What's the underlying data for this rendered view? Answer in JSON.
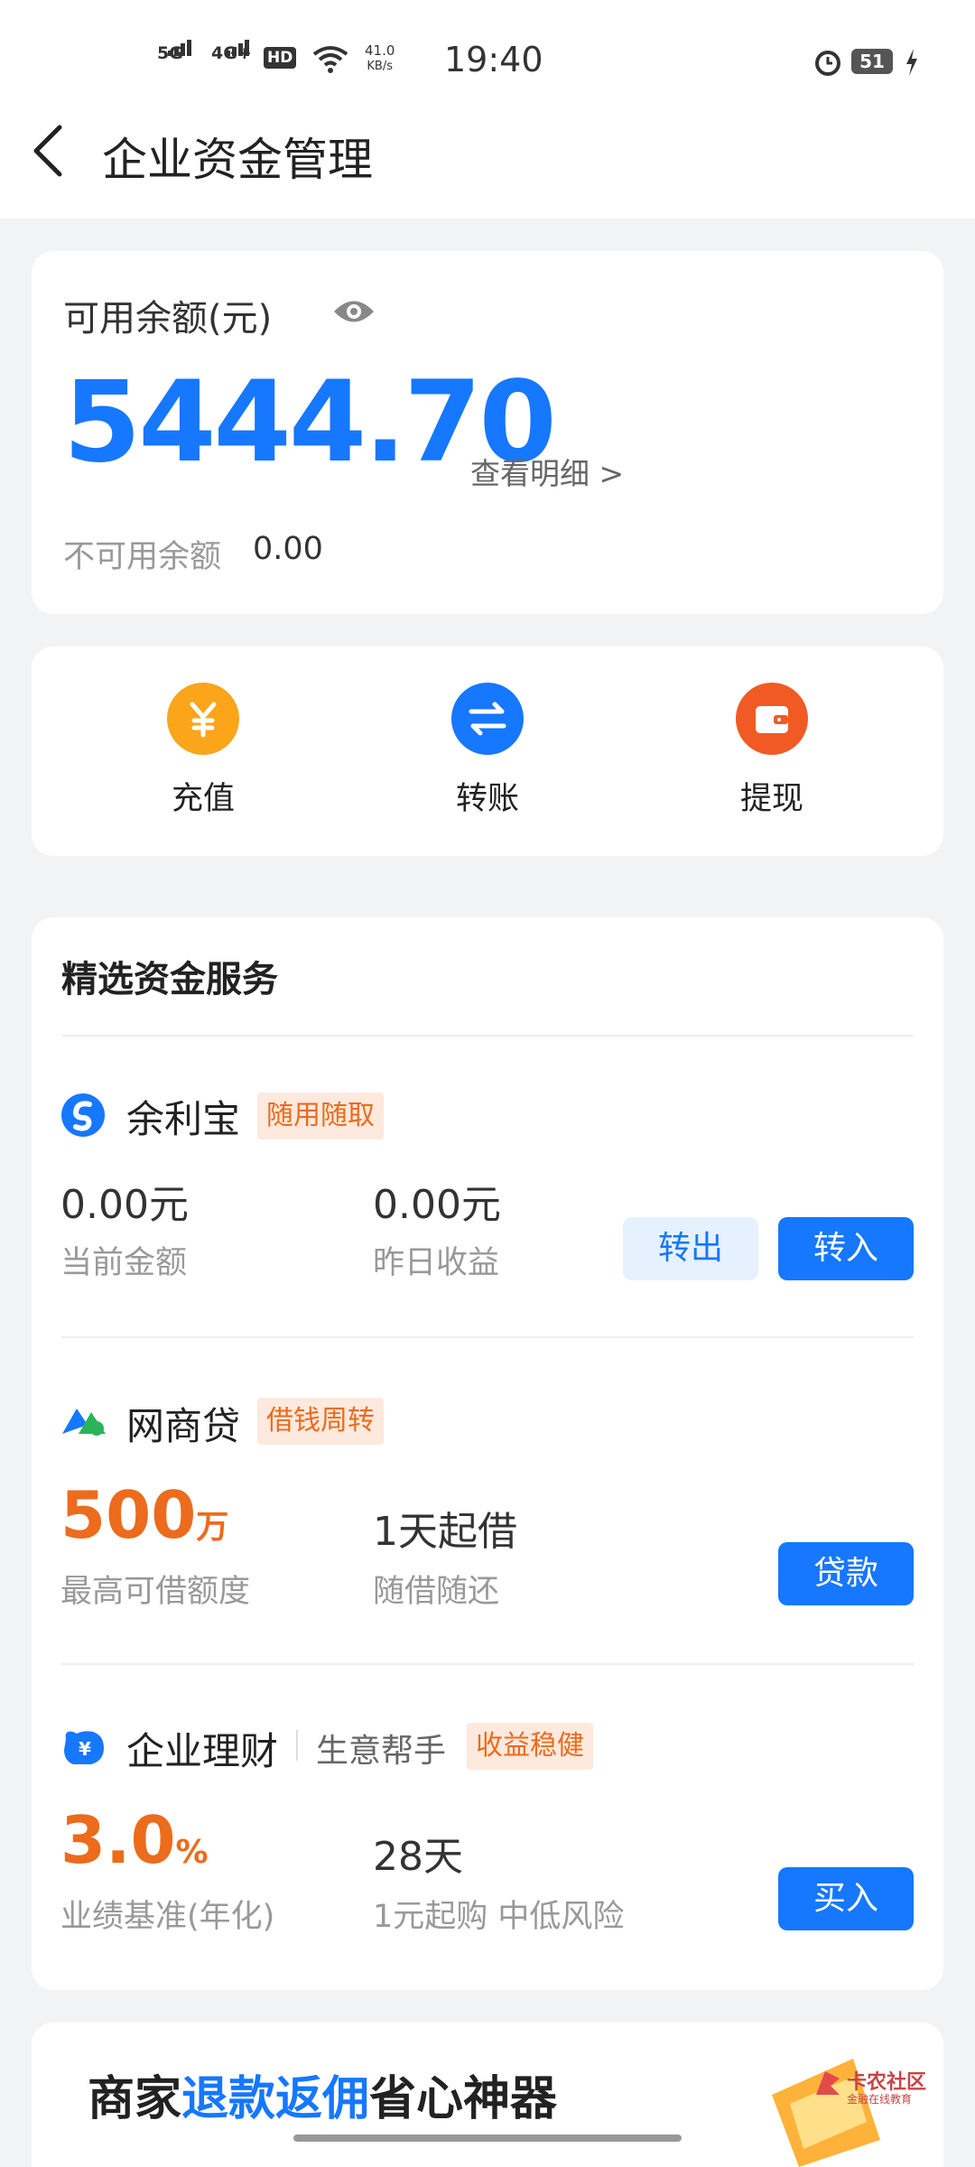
{
  "status_bar": {
    "signal_5g": "5G",
    "signal_4g": "4G+",
    "hd": "HD",
    "speed_value": "41.0",
    "speed_unit": "KB/s",
    "time": "19:40",
    "battery": "51"
  },
  "header": {
    "title": "企业资金管理"
  },
  "balance": {
    "label": "可用余额(元)",
    "amount": "5444.70",
    "detail_link": "查看明细 >",
    "unavailable_label": "不可用余额",
    "unavailable_value": "0.00"
  },
  "quick_actions": [
    {
      "label": "充值",
      "icon": "yuan-icon",
      "color": "#faa51a"
    },
    {
      "label": "转账",
      "icon": "transfer-icon",
      "color": "#1677ff"
    },
    {
      "label": "提现",
      "icon": "wallet-icon",
      "color": "#f15a24"
    }
  ],
  "services": {
    "section_title": "精选资金服务",
    "yulibao": {
      "name": "余利宝",
      "tag": "随用随取",
      "value1": "0.00元",
      "label1": "当前金额",
      "value2": "0.00元",
      "label2": "昨日收益",
      "btn_out": "转出",
      "btn_in": "转入"
    },
    "wangshangdai": {
      "name": "网商贷",
      "tag": "借钱周转",
      "value1_num": "500",
      "value1_unit": "万",
      "label1": "最高可借额度",
      "value2": "1天起借",
      "label2": "随借随还",
      "btn": "贷款"
    },
    "licai": {
      "name": "企业理财",
      "subname": "生意帮手",
      "tag": "收益稳健",
      "value1_num": "3.0",
      "value1_unit": "%",
      "label1": "业绩基准(年化)",
      "value2": "28天",
      "label2": "1元起购 中低风险",
      "btn": "买入"
    }
  },
  "banner": {
    "text_a": "商家",
    "text_b": "退款返佣",
    "text_c": "省心神器"
  },
  "watermark": {
    "text": "卡农社区",
    "sub": "金融在线教育"
  },
  "colors": {
    "accent": "#1677ff",
    "orange": "#ec6b1c"
  }
}
